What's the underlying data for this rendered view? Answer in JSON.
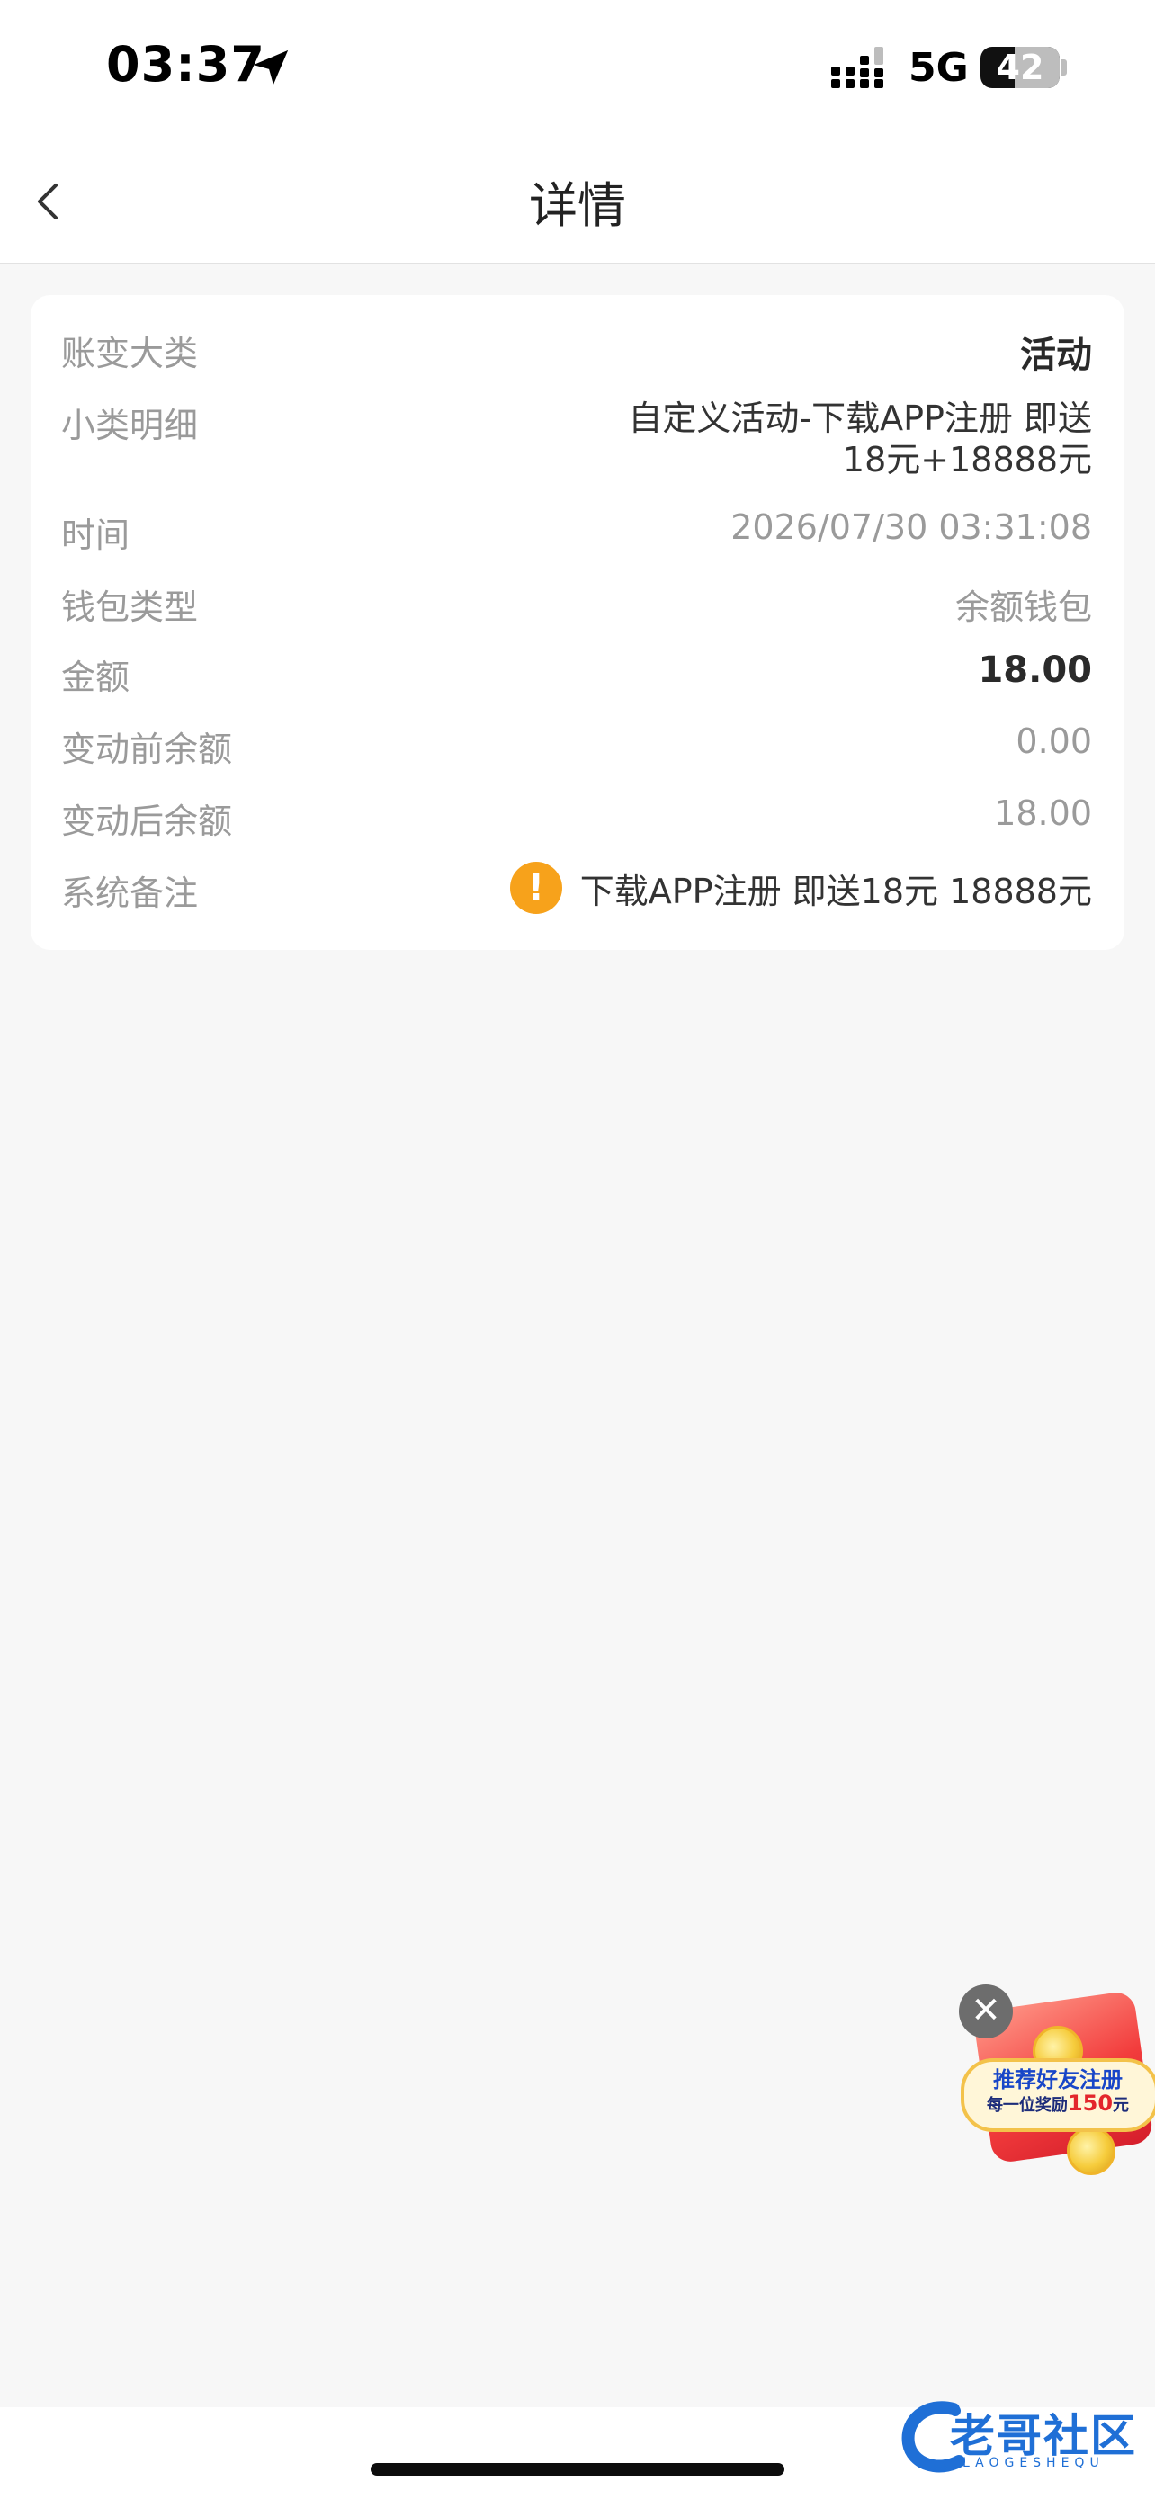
{
  "status_bar": {
    "time": "03:37",
    "network": "5G",
    "battery": "42"
  },
  "nav": {
    "title": "详情"
  },
  "detail": {
    "rows": [
      {
        "label": "账变大类",
        "value": "活动"
      },
      {
        "label": "小类明细",
        "value": "自定义活动-下载APP注册 即送18元+18888元"
      },
      {
        "label": "时间",
        "value": "2026/07/30 03:31:08"
      },
      {
        "label": "钱包类型",
        "value": "余额钱包"
      },
      {
        "label": "金额",
        "value": "18.00"
      },
      {
        "label": "变动前余额",
        "value": "0.00"
      },
      {
        "label": "变动后余额",
        "value": "18.00"
      },
      {
        "label": "系统备注",
        "value": "下载APP注册 即送18元 18888元"
      }
    ],
    "warning_icon": "!"
  },
  "promo": {
    "close": "✕",
    "title": "推荐好友注册",
    "subtitle_prefix": "每一位奖励",
    "amount": "150",
    "unit": "元"
  },
  "watermark": {
    "name": "老哥社区",
    "sub": "LAOGESHEQU"
  },
  "colors": {
    "accent_warning": "#f7a21b",
    "label_gray": "#9a9a9a",
    "background": "#f7f7f7",
    "promo_blue": "#1846c8",
    "promo_red": "#e3262c"
  },
  "icons": {
    "back": "chevron-left-icon",
    "location": "location-arrow-icon",
    "signal": "cellular-signal-icon",
    "warning": "warning-icon",
    "close": "close-icon"
  }
}
